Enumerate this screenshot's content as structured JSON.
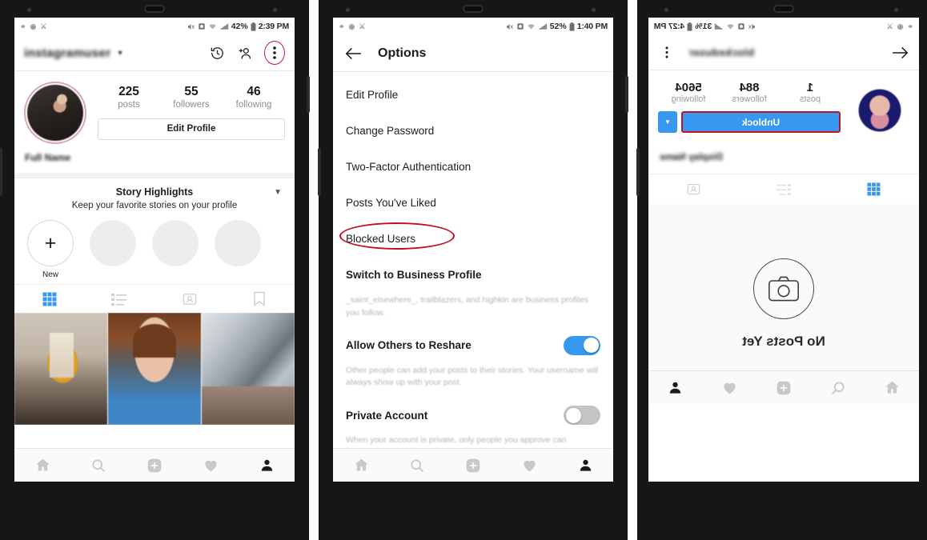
{
  "phone1": {
    "status": {
      "left_icons": [
        "notif-icon-1",
        "notif-icon-2",
        "notif-icon-3"
      ],
      "mute": "mute-icon",
      "alarm": "alarm-icon",
      "wifi": "wifi-icon",
      "signal": "signal-icon",
      "battery_pct": "42%",
      "time": "2:39 PM"
    },
    "topnav": {
      "username": "instagramuser",
      "caret": "chevron-down-icon",
      "history_icon": "clock-history-icon",
      "adduser_icon": "add-person-icon",
      "menu_icon": "three-dot-menu-icon"
    },
    "profile": {
      "stats": [
        {
          "value": "225",
          "label": "posts"
        },
        {
          "value": "55",
          "label": "followers"
        },
        {
          "value": "46",
          "label": "following"
        }
      ],
      "edit_button": "Edit Profile",
      "bio": "Full Name"
    },
    "highlights": {
      "title": "Story Highlights",
      "subtitle": "Keep your favorite stories on your profile",
      "caret": "chevron-down-icon",
      "new_label": "New",
      "new_plus": "+",
      "placeholders": 3
    },
    "tabs": [
      {
        "name": "grid-tab",
        "active": true
      },
      {
        "name": "list-tab",
        "active": false
      },
      {
        "name": "tagged-tab",
        "active": false
      },
      {
        "name": "saved-tab",
        "active": false
      }
    ],
    "bottomnav": [
      {
        "name": "home-tab",
        "selected": false
      },
      {
        "name": "search-tab",
        "selected": false
      },
      {
        "name": "add-post-tab",
        "selected": false
      },
      {
        "name": "activity-tab",
        "selected": false
      },
      {
        "name": "profile-tab",
        "selected": true
      }
    ]
  },
  "phone2": {
    "status": {
      "battery_pct": "52%",
      "time": "1:40 PM"
    },
    "header": {
      "back_icon": "back-arrow-icon",
      "title": "Options"
    },
    "items": [
      "Edit Profile",
      "Change Password",
      "Two-Factor Authentication",
      "Posts You've Liked",
      "Blocked Users",
      "Switch to Business Profile"
    ],
    "business_help": "_saint_elsewhere_, trailblazers, and highkin are business profiles you follow.",
    "reshare": {
      "label": "Allow Others to Reshare",
      "state": "on",
      "help": "Other people can add your posts to their stories. Your username will always show up with your post."
    },
    "private": {
      "label": "Private Account",
      "state": "off",
      "help": "When your account is private, only people you approve can"
    },
    "highlight_target": "Blocked Users",
    "bottomnav": [
      {
        "name": "home-tab",
        "selected": false
      },
      {
        "name": "search-tab",
        "selected": false
      },
      {
        "name": "add-post-tab",
        "selected": false
      },
      {
        "name": "activity-tab",
        "selected": false
      },
      {
        "name": "profile-tab",
        "selected": true
      }
    ]
  },
  "phone3": {
    "status": {
      "battery_pct": "31%",
      "time": "4:27 PM"
    },
    "header": {
      "back_icon": "back-arrow-icon",
      "username": "blockeduser",
      "menu_icon": "three-dot-menu-icon"
    },
    "profile": {
      "stats": [
        {
          "value": "1",
          "label": "posts"
        },
        {
          "value": "884",
          "label": "followers"
        },
        {
          "value": "5604",
          "label": "following"
        }
      ],
      "unblock_button": "Unblock",
      "dropdown_icon": "chevron-down-icon",
      "bio": "Display Name"
    },
    "tabs": [
      {
        "name": "grid-tab",
        "active": true
      },
      {
        "name": "list-tab",
        "active": false
      },
      {
        "name": "tagged-tab",
        "active": false
      }
    ],
    "empty": {
      "camera_icon": "camera-icon",
      "text": "No Posts Yet"
    },
    "bottomnav": [
      {
        "name": "home-tab",
        "selected": false
      },
      {
        "name": "search-tab",
        "selected": false
      },
      {
        "name": "add-post-tab",
        "selected": false
      },
      {
        "name": "activity-tab",
        "selected": false
      },
      {
        "name": "profile-tab",
        "selected": true
      }
    ]
  },
  "colors": {
    "ig_blue": "#3897f0",
    "highlight_red": "#c1121f",
    "avatar_ring": "#d9a3b8",
    "muted_text": "#8d8d8d"
  }
}
